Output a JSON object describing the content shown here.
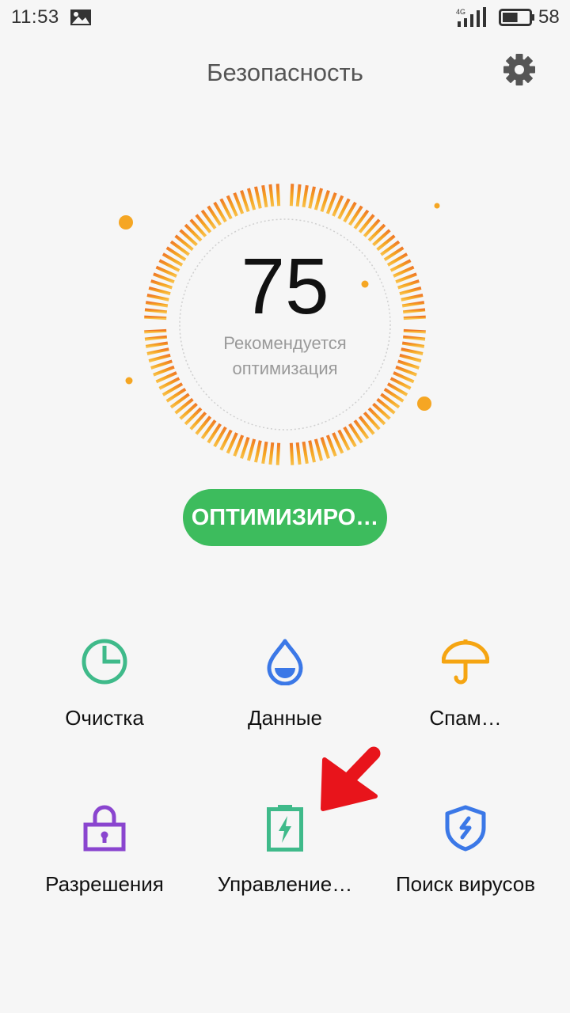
{
  "status_bar": {
    "time": "11:53",
    "network": "4G",
    "battery_level": "58",
    "battery_fraction": 0.58
  },
  "header": {
    "title": "Безопасность",
    "settings_icon": "gear-icon"
  },
  "score": {
    "value": "75",
    "caption_line1": "Рекомендуется",
    "caption_line2": "оптимизация",
    "ring_colors": [
      "#f07a28",
      "#f5a623",
      "#f9c04a"
    ]
  },
  "optimize_button": {
    "label": "ОПТИМИЗИРО…",
    "color": "#3dbc5d"
  },
  "features": [
    {
      "label": "Очистка",
      "icon": "pie-clock-icon",
      "color": "#3fba8a"
    },
    {
      "label": "Данные",
      "icon": "water-drop-icon",
      "color": "#3b78e7"
    },
    {
      "label": "Спам…",
      "icon": "umbrella-icon",
      "color": "#f5a512"
    },
    {
      "label": "Разрешения",
      "icon": "lock-icon",
      "color": "#8a45cf"
    },
    {
      "label": "Управление…",
      "icon": "battery-charge-icon",
      "color": "#3fba8a"
    },
    {
      "label": "Поиск вирусов",
      "icon": "shield-icon",
      "color": "#3b78e7"
    }
  ],
  "annotation": {
    "arrow_icon": "red-arrow-icon",
    "color": "#e8141b"
  }
}
